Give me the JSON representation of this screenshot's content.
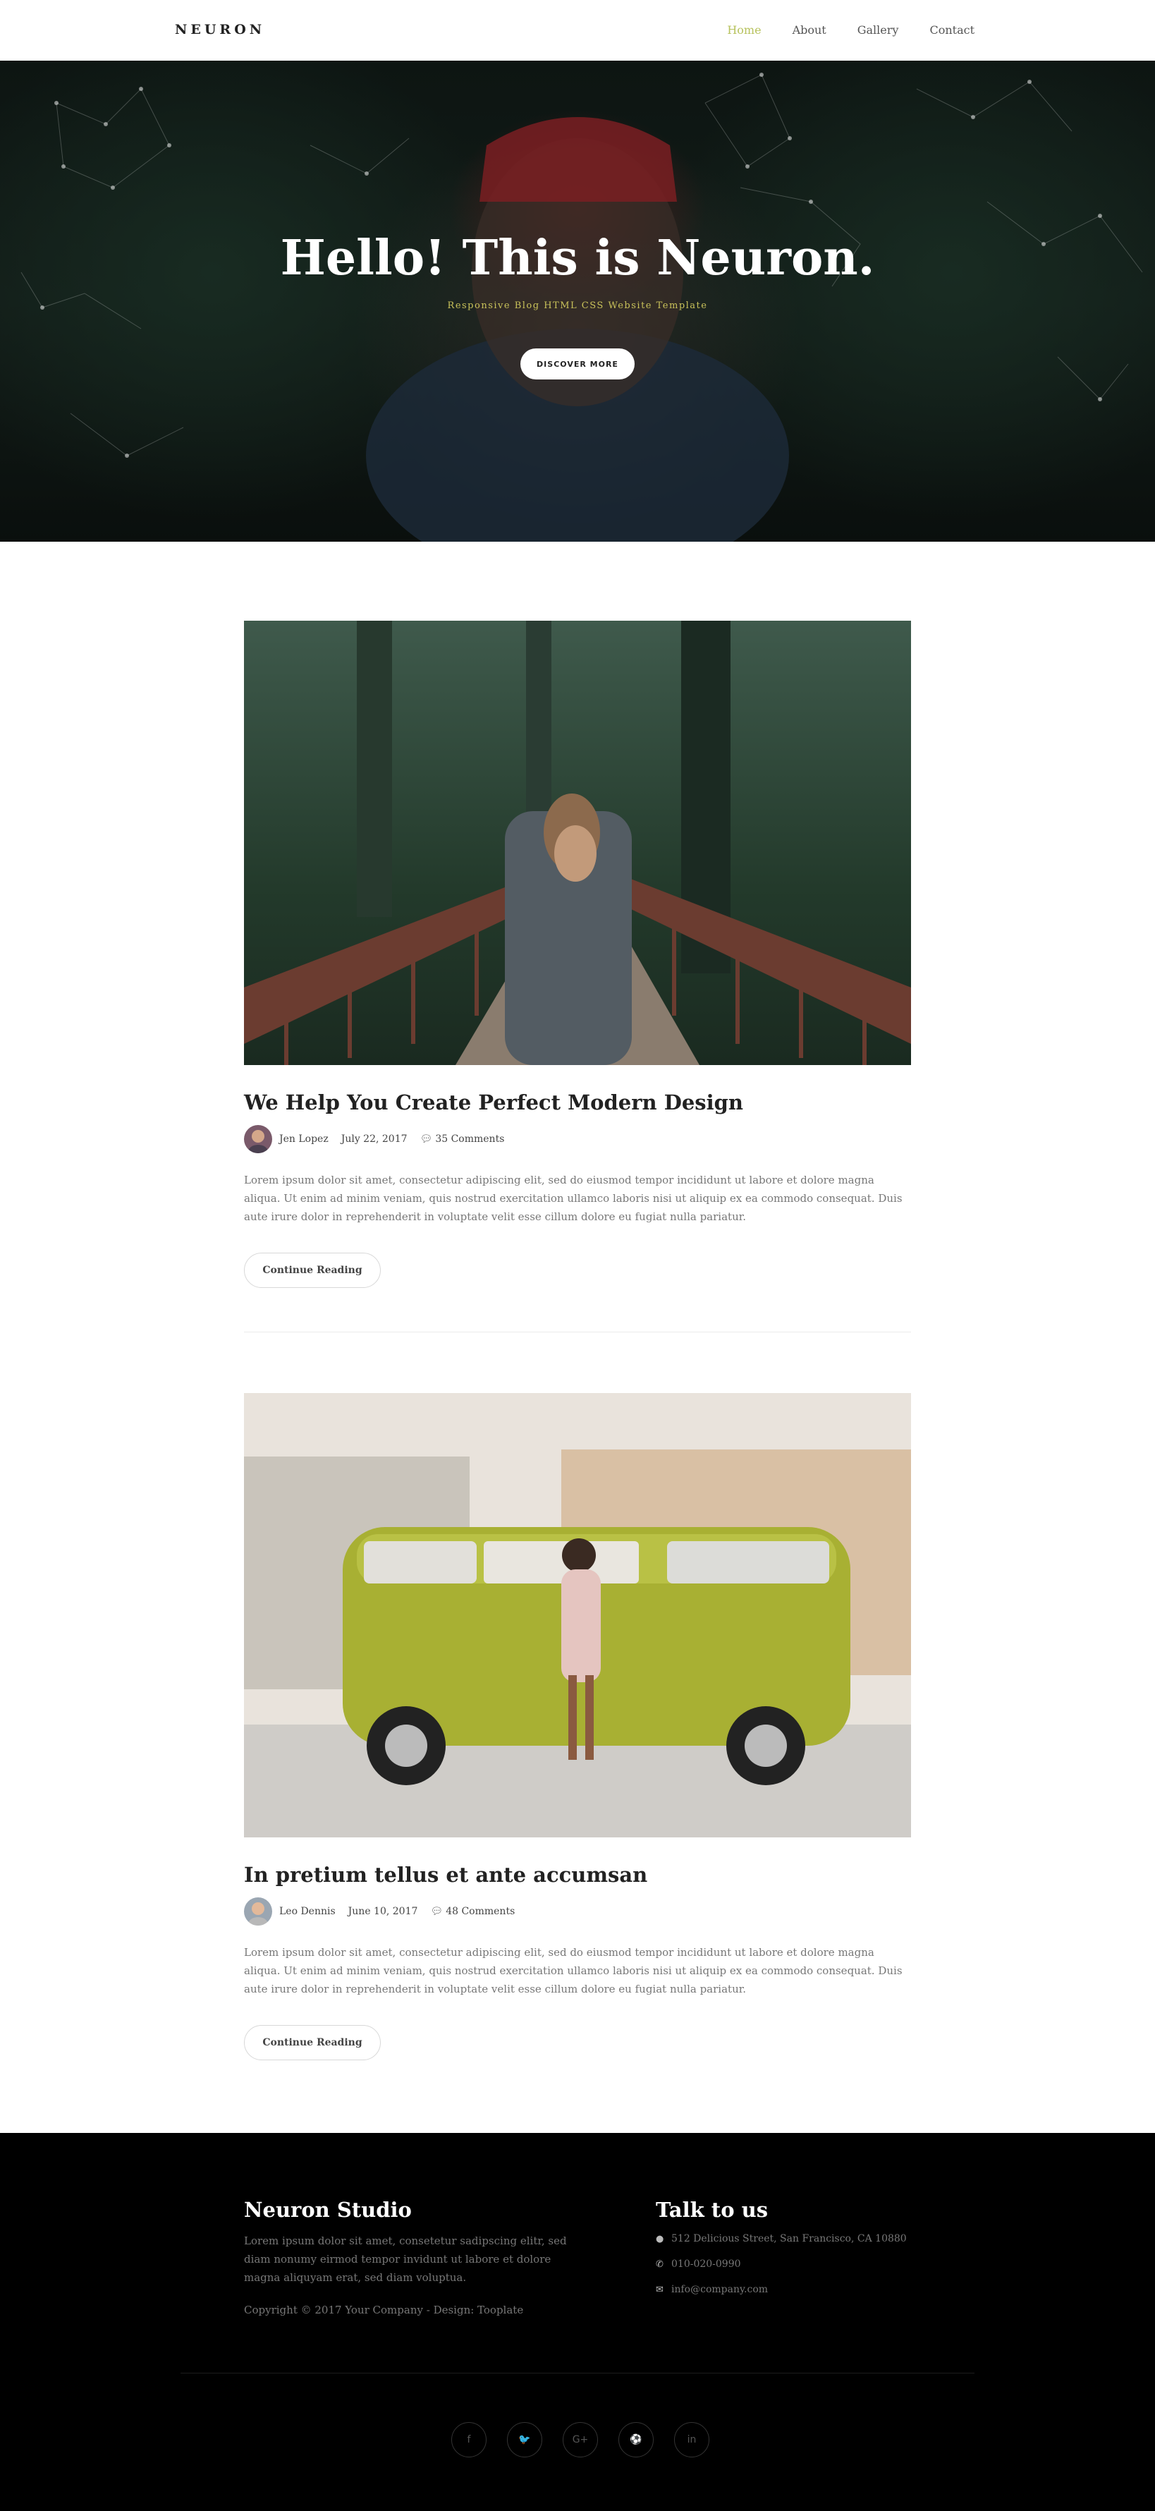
{
  "nav": {
    "brand": "NEURON",
    "links": [
      {
        "label": "Home",
        "active": true
      },
      {
        "label": "About",
        "active": false
      },
      {
        "label": "Gallery",
        "active": false
      },
      {
        "label": "Contact",
        "active": false
      }
    ],
    "active_color": "#b7c25d"
  },
  "hero": {
    "title": "Hello! This is Neuron.",
    "subtitle": "Responsive Blog HTML CSS Website Template",
    "button": "DISCOVER MORE",
    "subtitle_color": "#c9c25a"
  },
  "posts": [
    {
      "title": "We Help You Create Perfect Modern Design",
      "author": "Jen Lopez",
      "date": "July 22, 2017",
      "comments": "35 Comments",
      "excerpt": "Lorem ipsum dolor sit amet, consectetur adipiscing elit, sed do eiusmod tempor incididunt ut labore et dolore magna aliqua. Ut enim ad minim veniam, quis nostrud exercitation ullamco laboris nisi ut aliquip ex ea commodo consequat. Duis aute irure dolor in reprehenderit in voluptate velit esse cillum dolore eu fugiat nulla pariatur.",
      "button": "Continue Reading"
    },
    {
      "title": "In pretium tellus et ante accumsan",
      "author": "Leo Dennis",
      "date": "June 10, 2017",
      "comments": "48 Comments",
      "excerpt": "Lorem ipsum dolor sit amet, consectetur adipiscing elit, sed do eiusmod tempor incididunt ut labore et dolore magna aliqua. Ut enim ad minim veniam, quis nostrud exercitation ullamco laboris nisi ut aliquip ex ea commodo consequat. Duis aute irure dolor in reprehenderit in voluptate velit esse cillum dolore eu fugiat nulla pariatur.",
      "button": "Continue Reading"
    }
  ],
  "footer": {
    "studio_title": "Neuron Studio",
    "studio_text": "Lorem ipsum dolor sit amet, consetetur sadipscing elitr, sed diam nonumy eirmod tempor invidunt ut labore et dolore magna aliquyam erat, sed diam voluptua.",
    "copyright": "Copyright © 2017 Your Company - Design: Tooplate",
    "contact_title": "Talk to us",
    "address": "512 Delicious Street, San Francisco, CA 10880",
    "phone": "010-020-0990",
    "email": "info@company.com",
    "socials": [
      {
        "icon": "facebook-icon",
        "glyph": "f"
      },
      {
        "icon": "twitter-icon",
        "glyph": "🐦"
      },
      {
        "icon": "google-plus-icon",
        "glyph": "G+"
      },
      {
        "icon": "dribbble-icon",
        "glyph": "⚽"
      },
      {
        "icon": "linkedin-icon",
        "glyph": "in"
      }
    ]
  }
}
